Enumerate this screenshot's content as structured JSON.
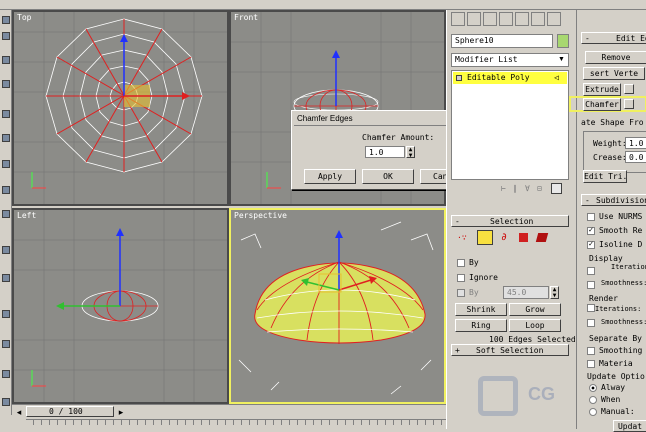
{
  "viewports": {
    "top": {
      "label": "Top"
    },
    "front": {
      "label": "Front"
    },
    "left": {
      "label": "Left"
    },
    "perspective": {
      "label": "Perspective"
    }
  },
  "dialog": {
    "title": "Chamfer Edges",
    "amount_label": "Chamfer Amount:",
    "amount_value": "1.0",
    "apply": "Apply",
    "ok": "OK",
    "cancel": "Cancel",
    "close": "×"
  },
  "command_panel": {
    "object_name": "Sphere10",
    "modifier_list": "Modifier List",
    "stack_item": "Editable Poly",
    "selection": {
      "title": "Selection",
      "by_vertex": "By",
      "ignore": "Ignore",
      "by_angle": "By",
      "angle_value": "45.0",
      "shrink": "Shrink",
      "grow": "Grow",
      "ring": "Ring",
      "loop": "Loop",
      "status": "100 Edges Selected"
    },
    "soft_selection": "Soft Selection"
  },
  "right_panel": {
    "edit_edges": "Edit Edg",
    "remove": "Remove",
    "insert_vertex": "sert Verte",
    "extrude": "Extrude",
    "chamfer": "Chamfer",
    "create_shape": "ate Shape Fro",
    "weight_label": "Weight:",
    "weight_value": "1.0",
    "crease_label": "Crease:",
    "crease_value": "0.0",
    "edit_tri": "Edit Tri.",
    "subdivision": "Subdivision",
    "use_nurms": "Use NURMS",
    "smooth_result": "Smooth Re",
    "isoline": "Isoline D",
    "display": "Display",
    "iterations": "Iterations:",
    "smoothness": "Smoothness:",
    "render": "Render",
    "render_iterations": "Iterations:",
    "render_smoothness": "Smoothness:",
    "separate_by": "Separate By",
    "smoothing": "Smoothing",
    "materials": "Materia",
    "update_options": "Update Optio",
    "always": "Alway",
    "when": "When",
    "manual": "Manual:",
    "update": "Updat"
  },
  "timeline": {
    "frame": "0 / 100"
  },
  "watermark": "CG",
  "colors": {
    "viewport_bg": "#8c8c88",
    "wire_white": "#ffffff",
    "wire_red": "#e02020",
    "active_border": "#f0f060",
    "sphere_fill": "#d8e060"
  }
}
